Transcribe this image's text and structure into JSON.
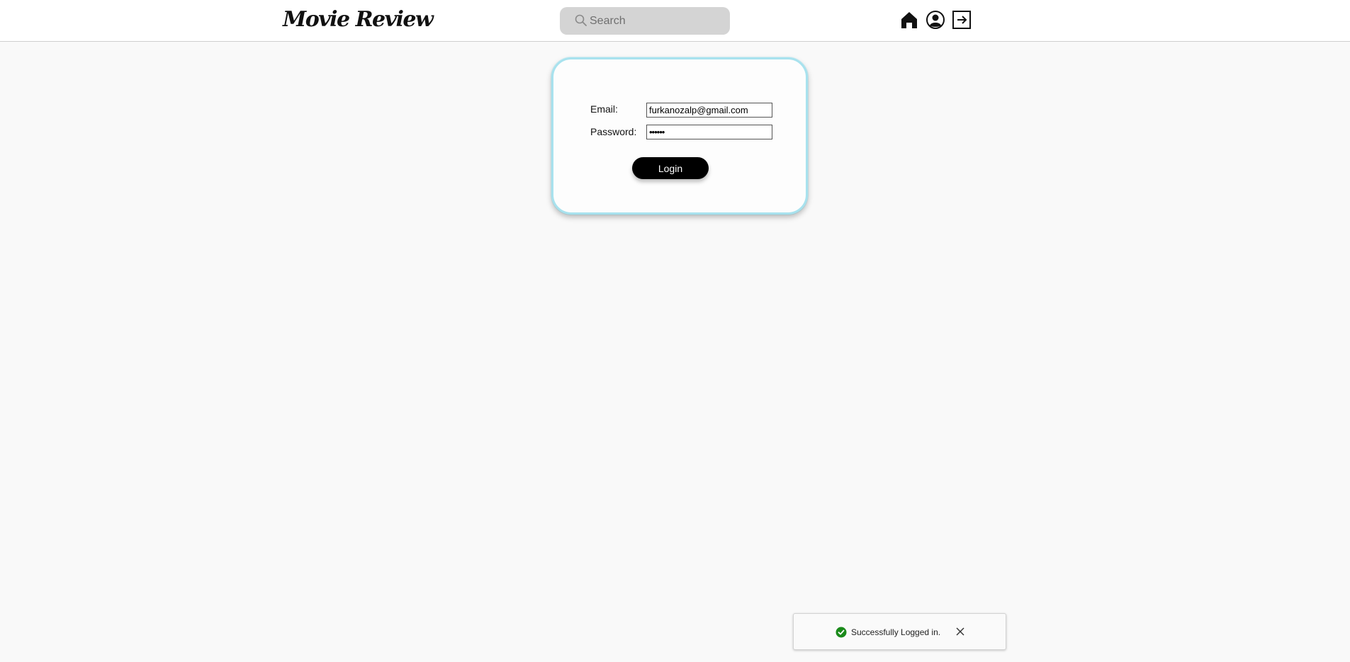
{
  "header": {
    "logo_text": "Movie Review",
    "search": {
      "placeholder": "Search",
      "value": ""
    },
    "icons": [
      "home-icon",
      "user-profile-icon",
      "logout-icon"
    ]
  },
  "login_form": {
    "email_label": "Email:",
    "email_value": "furkanozalp@gmail.com",
    "password_label": "Password:",
    "password_value": "••••••",
    "submit_label": "Login",
    "card_border_color": "#a8e2ee"
  },
  "toast": {
    "status": "success",
    "icon": "check-circle-icon",
    "message": "Successfully Logged in.",
    "close_icon": "close-icon",
    "success_color": "#1a8a1a"
  }
}
